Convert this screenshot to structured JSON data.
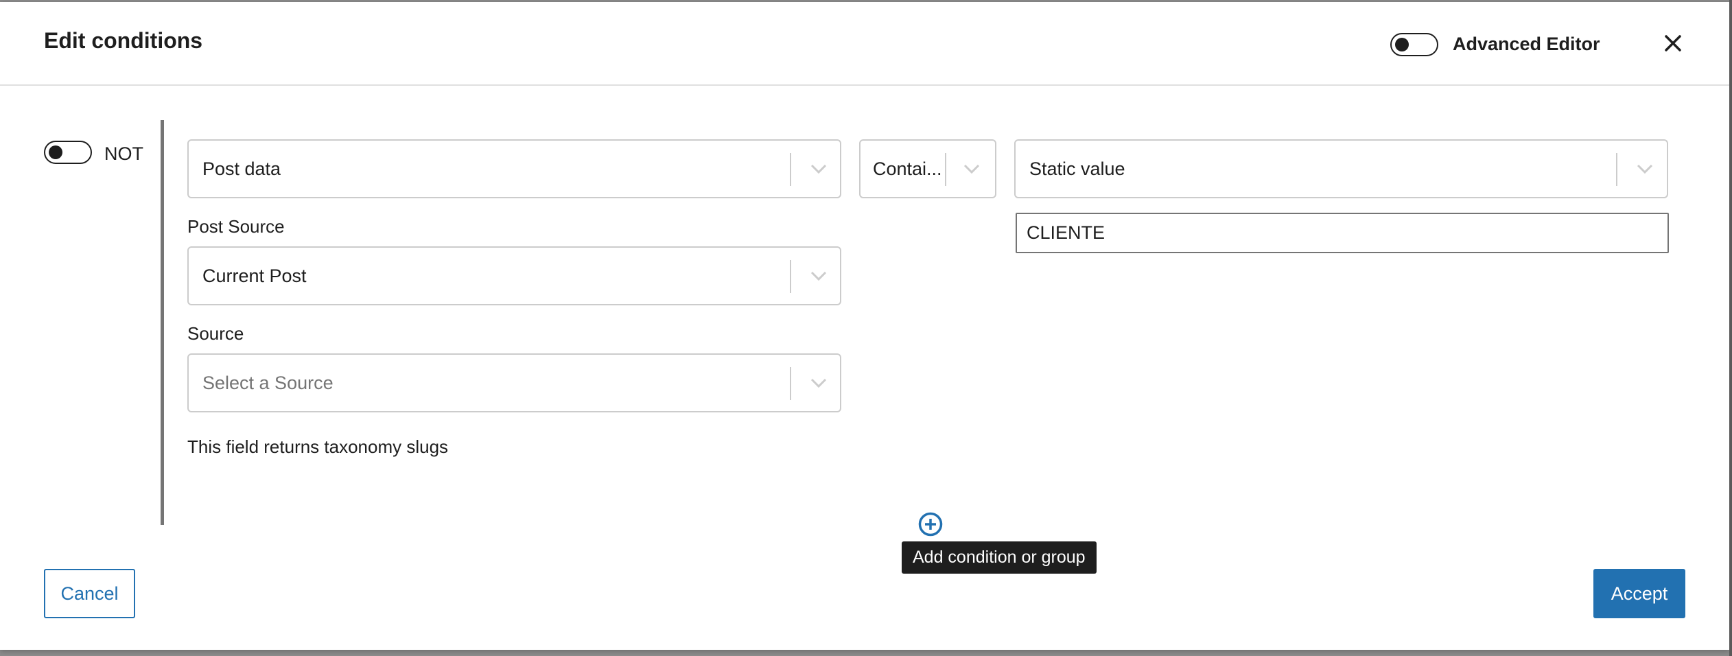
{
  "header": {
    "title": "Edit conditions",
    "advanced_editor_label": "Advanced Editor",
    "advanced_editor_on": false,
    "close_icon": "close-icon"
  },
  "condition": {
    "not_label": "NOT",
    "not_on": false,
    "left_select": {
      "value": "Post data"
    },
    "operator_select": {
      "value": "Contai..."
    },
    "right_select": {
      "value": "Static value"
    },
    "right_input": {
      "value": "CLIENTE"
    },
    "post_source": {
      "label": "Post Source",
      "value": "Current Post"
    },
    "source": {
      "label": "Source",
      "placeholder": "Select a Source"
    },
    "help_text": "This field returns taxonomy slugs"
  },
  "add_condition": {
    "icon": "plus-circle-icon",
    "tooltip": "Add condition or group"
  },
  "footer": {
    "cancel_label": "Cancel",
    "accept_label": "Accept"
  },
  "colors": {
    "accent": "#2271b1",
    "text": "#1e1e1e",
    "border": "#cccccc",
    "tooltip_bg": "#1e1e1e"
  }
}
